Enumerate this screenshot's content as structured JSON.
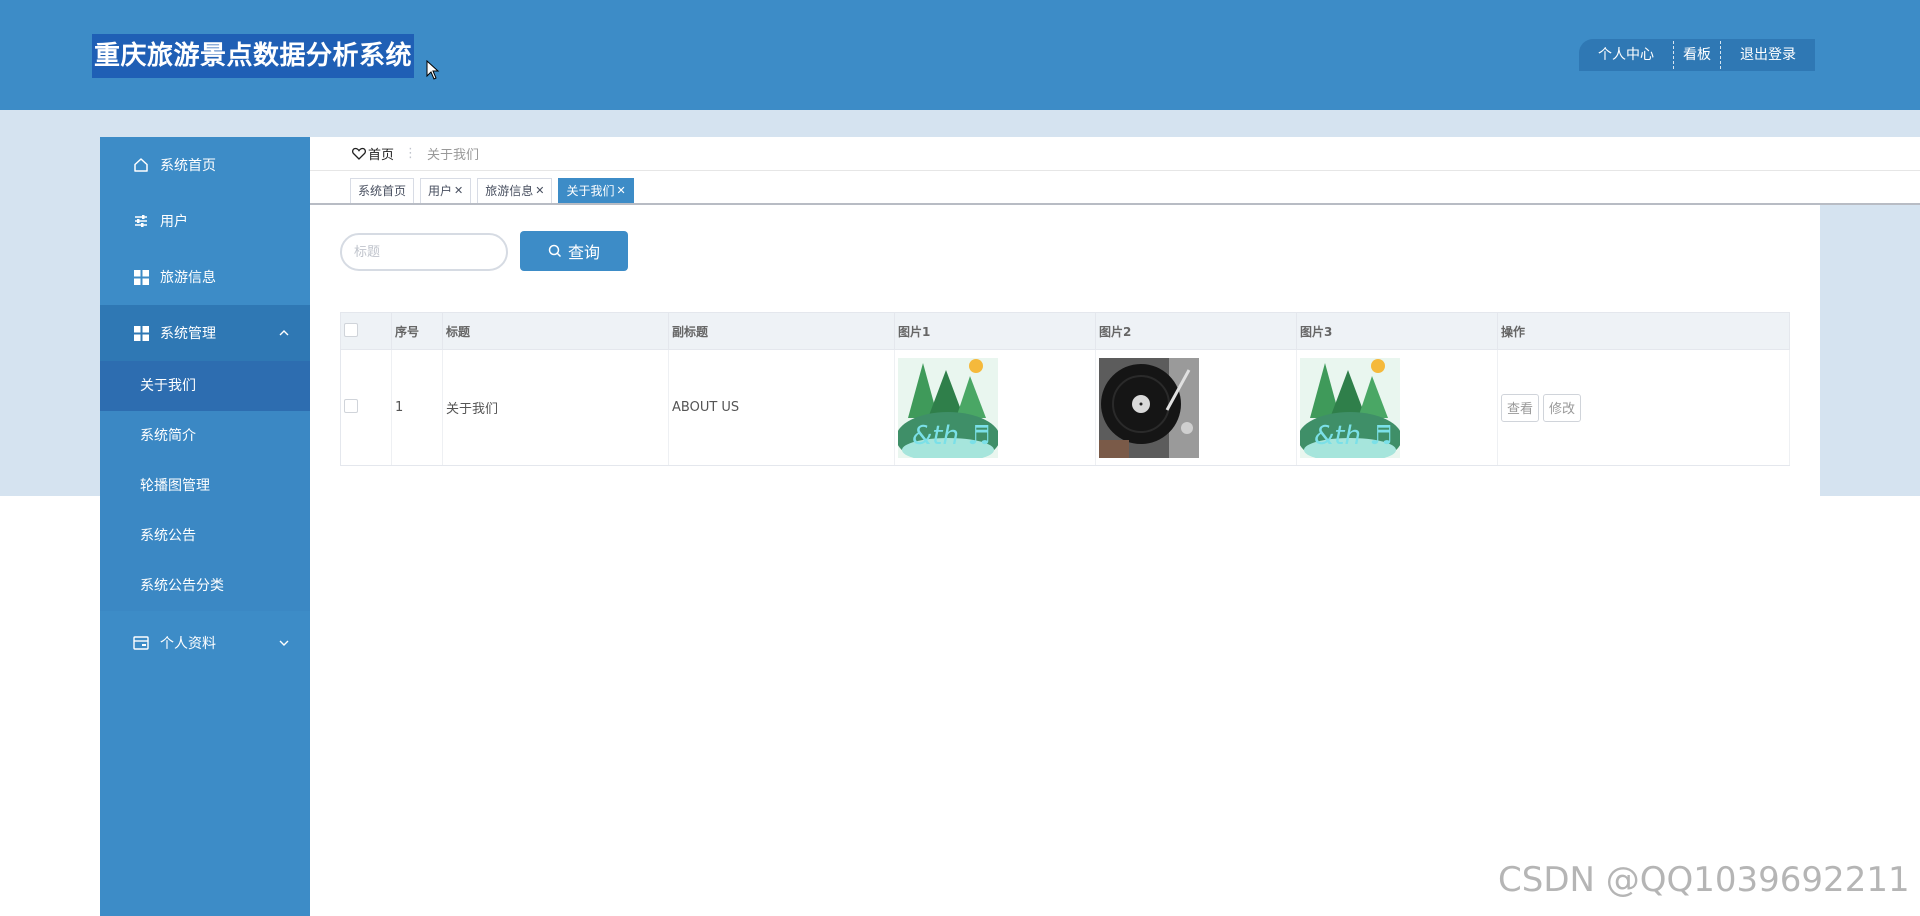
{
  "app": {
    "title": "重庆旅游景点数据分析系统"
  },
  "header_actions": [
    {
      "label": "个人中心"
    },
    {
      "label": "看板"
    },
    {
      "label": "退出登录"
    }
  ],
  "sidebar": {
    "items": [
      {
        "label": "系统首页",
        "icon": "home-icon"
      },
      {
        "label": "用户",
        "icon": "sliders-icon"
      },
      {
        "label": "旅游信息",
        "icon": "grid-icon"
      },
      {
        "label": "系统管理",
        "icon": "grid-icon",
        "expanded": true,
        "children": [
          {
            "label": "关于我们",
            "active": true
          },
          {
            "label": "系统简介"
          },
          {
            "label": "轮播图管理"
          },
          {
            "label": "系统公告"
          },
          {
            "label": "系统公告分类"
          }
        ]
      },
      {
        "label": "个人资料",
        "icon": "card-icon",
        "expanded": false
      }
    ]
  },
  "breadcrumb": {
    "home": "首页",
    "current": "关于我们"
  },
  "tabs": [
    {
      "label": "系统首页",
      "closable": false
    },
    {
      "label": "用户",
      "closable": true
    },
    {
      "label": "旅游信息",
      "closable": true
    },
    {
      "label": "关于我们",
      "closable": true,
      "active": true
    }
  ],
  "search": {
    "placeholder": "标题",
    "value": "",
    "button_label": "查询"
  },
  "table": {
    "columns": [
      "序号",
      "标题",
      "副标题",
      "图片1",
      "图片2",
      "图片3",
      "操作"
    ],
    "rows": [
      {
        "index": "1",
        "title": "关于我们",
        "subtitle": "ABOUT US",
        "images": [
          "forest-illustration",
          "vinyl-turntable-photo",
          "forest-illustration"
        ],
        "actions": [
          "查看",
          "修改"
        ]
      }
    ]
  },
  "watermark": "CSDN @QQ1039692211",
  "colors": {
    "primary": "#3d8cc7",
    "sidebar_active": "#2d6db0",
    "title_highlight": "#1f5fb5",
    "band": "#d5e3f0"
  }
}
